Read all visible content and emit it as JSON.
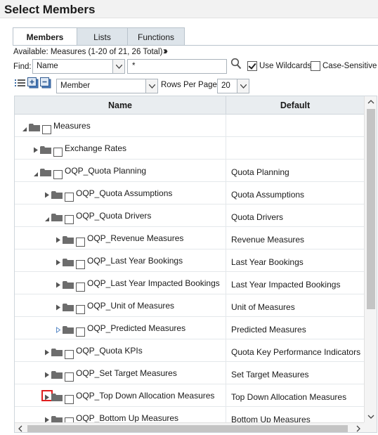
{
  "page": {
    "title": "Select Members"
  },
  "tabs": [
    {
      "label": "Members",
      "active": true
    },
    {
      "label": "Lists",
      "active": false
    },
    {
      "label": "Functions",
      "active": false
    }
  ],
  "available_text": "Available:  Measures (1-20 of 21, 26 Total)",
  "find": {
    "label": "Find:",
    "field_value": "Name",
    "search_value": "*",
    "use_wildcards": {
      "label": "Use Wildcards",
      "checked": true
    },
    "case_sensitive": {
      "label": "Case-Sensitive",
      "checked": false
    }
  },
  "view": {
    "selector_value": "Member",
    "rows_per_page_label": "Rows Per Page:",
    "rows_per_page_value": "20"
  },
  "grid": {
    "headers": {
      "name": "Name",
      "default": "Default"
    },
    "rows": [
      {
        "name": "Measures",
        "default": "",
        "level": 0,
        "twisty": "expanded"
      },
      {
        "name": "Exchange Rates",
        "default": "",
        "level": 1,
        "twisty": "collapsed"
      },
      {
        "name": "OQP_Quota Planning",
        "default": "Quota Planning",
        "level": 1,
        "twisty": "expanded"
      },
      {
        "name": "OQP_Quota Assumptions",
        "default": "Quota Assumptions",
        "level": 2,
        "twisty": "collapsed"
      },
      {
        "name": "OQP_Quota Drivers",
        "default": "Quota Drivers",
        "level": 2,
        "twisty": "expanded"
      },
      {
        "name": "OQP_Revenue Measures",
        "default": "Revenue Measures",
        "level": 3,
        "twisty": "collapsed"
      },
      {
        "name": "OQP_Last Year Bookings",
        "default": "Last Year Bookings",
        "level": 3,
        "twisty": "collapsed"
      },
      {
        "name": "OQP_Last Year Impacted Bookings",
        "default": "Last Year Impacted Bookings",
        "level": 3,
        "twisty": "collapsed"
      },
      {
        "name": "OQP_Unit of Measures",
        "default": "Unit of Measures",
        "level": 3,
        "twisty": "collapsed"
      },
      {
        "name": "OQP_Predicted Measures",
        "default": "Predicted Measures",
        "level": 3,
        "twisty": "collapsed-hollow"
      },
      {
        "name": "OQP_Quota KPIs",
        "default": "Quota Key Performance Indicators",
        "level": 2,
        "twisty": "collapsed"
      },
      {
        "name": "OQP_Set Target Measures",
        "default": "Set Target Measures",
        "level": 2,
        "twisty": "collapsed"
      },
      {
        "name": "OQP_Top Down Allocation Measures",
        "default": "Top Down Allocation Measures",
        "level": 2,
        "twisty": "collapsed",
        "highlighted": true
      },
      {
        "name": "OQP_Bottom Up Measures",
        "default": "Bottom Up Measures",
        "level": 2,
        "twisty": "collapsed"
      }
    ]
  },
  "colors": {
    "tab_bg": "#dde4ea",
    "header_bg": "#e9edf0",
    "highlight": "#e02020",
    "folder": "#6d6d6d"
  },
  "icons": {
    "search": "search-icon",
    "expand_all": "list-icon",
    "folder": "folder-icon"
  }
}
